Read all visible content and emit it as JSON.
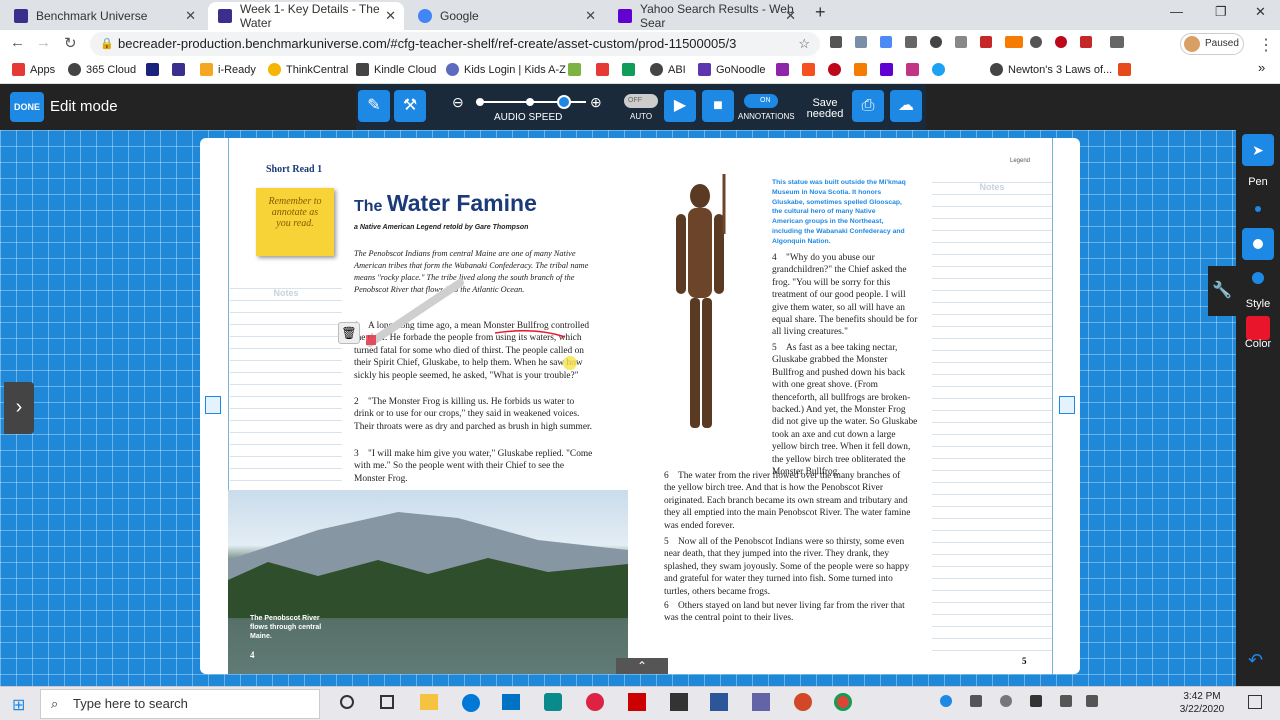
{
  "browser": {
    "tabs": [
      {
        "title": "Benchmark Universe",
        "color": "#3a2f8c"
      },
      {
        "title": "Week 1- Key Details - The Water",
        "color": "#3a2f8c"
      },
      {
        "title": "Google",
        "color": "#4285f4"
      },
      {
        "title": "Yahoo Search Results - Web Sear",
        "color": "#6001d2"
      }
    ],
    "url": "becreader-production.benchmarkuniverse.com/#cfg-teacher-shelf/ref-create/asset-custom/prod-11500005/3",
    "profile": "Paused",
    "bookmarks": [
      "Apps",
      "365 Cloud",
      "i-Ready",
      "ThinkCentral",
      "Kindle Cloud",
      "Kids Login | Kids A-Z",
      "ABI",
      "GoNoodle",
      "Newton's 3 Laws of..."
    ]
  },
  "app": {
    "done": "DONE",
    "mode": "Edit mode",
    "audio_speed": "AUDIO SPEED",
    "auto": "AUTO",
    "off": "OFF",
    "annotations": "ANNOTATIONS",
    "on": "ON",
    "save_needed": "Save needed",
    "pen": "Pen",
    "style": "Style",
    "color": "Color",
    "pen_color": "#e8152b",
    "audio_speed_value": 0.8
  },
  "page_left": {
    "label": "Short Read 1",
    "sticky": "Remember to annotate as you read.",
    "notes": "Notes",
    "title_the": "The",
    "title": "Water Famine",
    "subtitle": "a Native American Legend retold by Gare Thompson",
    "intro": "The Penobscot Indians from central Maine are one of many Native American tribes that form the Wabanaki Confederacy. The tribal name means \"rocky place.\" The tribe lived along the south branch of the Penobscot River that flows into the Atlantic Ocean.",
    "p1_num": "1",
    "p1": "A long, long time ago, a mean Monster Bullfrog controlled the river. He forbade the people from using its waters, which turned fatal for some who died of thirst. The people called on their Spirit Chief, Gluskabe, to help them. When he saw how sickly his people seemed, he asked, \"What is your trouble?\"",
    "p2_num": "2",
    "p2": "\"The Monster Frog is killing us. He forbids us water to drink or to use for our crops,\" they said in weakened voices. Their throats were as dry and parched as brush in high summer.",
    "p3_num": "3",
    "p3": "\"I will make him give you water,\" Gluskabe replied. \"Come with me.\" So the people went with their Chief to see the Monster Frog.",
    "caption": "The Penobscot River flows through central Maine.",
    "page_no": "4"
  },
  "page_right": {
    "legend": "Legend",
    "notes": "Notes",
    "statue_caption": "This statue was built outside the Mi'kmaq Museum in Nova Scotia. It honors Gluskabe, sometimes spelled Glooscap, the cultural hero of many Native American groups in the Northeast, including the Wabanaki Confederacy and Algonquin Nation.",
    "p4_num": "4",
    "p4": "\"Why do you abuse our grandchildren?\" the Chief asked the frog. \"You will be sorry for this treatment of our good people. I will give them water, so all will have an equal share. The benefits should be for all living creatures.\"",
    "p5_num": "5",
    "p5": "As fast as a bee taking nectar, Gluskabe grabbed the Monster Bullfrog and pushed down his back with one great shove. (From thenceforth, all bullfrogs are broken-backed.) And yet, the Monster Frog did not give up the water. So Gluskabe took an axe and cut down a large yellow birch tree. When it fell down, the yellow birch tree obliterated the Monster Bullfrog.",
    "p6_num": "6",
    "p6": "The water from the river flowed over the many branches of the yellow birch tree. And that is how the Penobscot River originated. Each branch became its own stream and tributary and they all emptied into the main Penobscot River. The water famine was ended forever.",
    "p7_num": "5",
    "p7": "Now all of the Penobscot Indians were so thirsty, some even near death, that they jumped into the river. They drank, they splashed, they swam joyously. Some of the people were so happy and grateful for water they turned into fish. Some turned into turtles, others became frogs.",
    "p8_num": "6",
    "p8": "Others stayed on land but never living far from the river that was the central point to their lives.",
    "page_no": "5"
  },
  "taskbar": {
    "search": "Type here to search",
    "time": "3:42 PM",
    "date": "3/22/2020"
  }
}
